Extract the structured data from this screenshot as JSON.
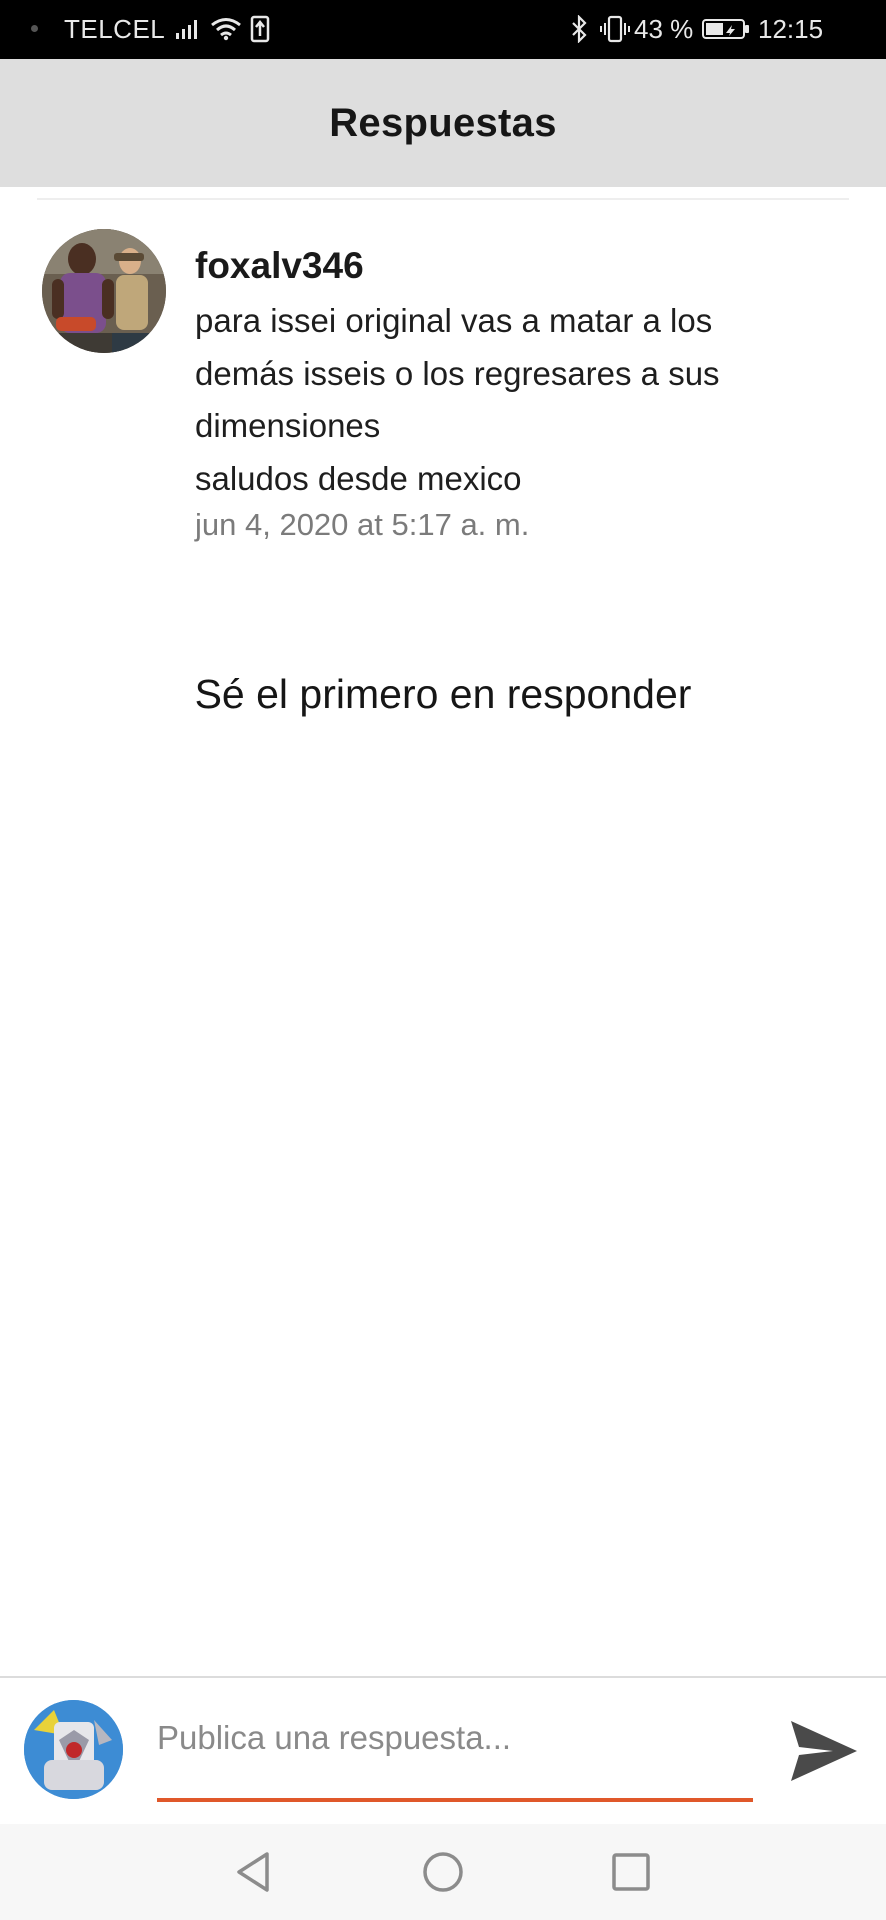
{
  "status_bar": {
    "carrier": "TELCEL",
    "battery": "43 %",
    "time": "12:15",
    "icons": [
      "signal-icon",
      "wifi-icon",
      "upload-icon",
      "bluetooth-icon",
      "vibrate-icon",
      "battery-icon"
    ]
  },
  "header": {
    "title": "Respuestas",
    "background": "#dedede"
  },
  "comment": {
    "username": "foxalv346",
    "text": "para issei original vas a matar a los demás isseis o los regresares a sus dimensiones\nsaludos desde mexico",
    "timestamp": "jun 4, 2020 at 5:17 a. m."
  },
  "empty_state": "Sé el primero en responder",
  "composer": {
    "placeholder": "Publica una respuesta...",
    "accent_color": "#e0582a",
    "send_icon": "send-icon"
  },
  "nav": {
    "icons": [
      "back-icon",
      "home-icon",
      "recents-icon"
    ]
  }
}
